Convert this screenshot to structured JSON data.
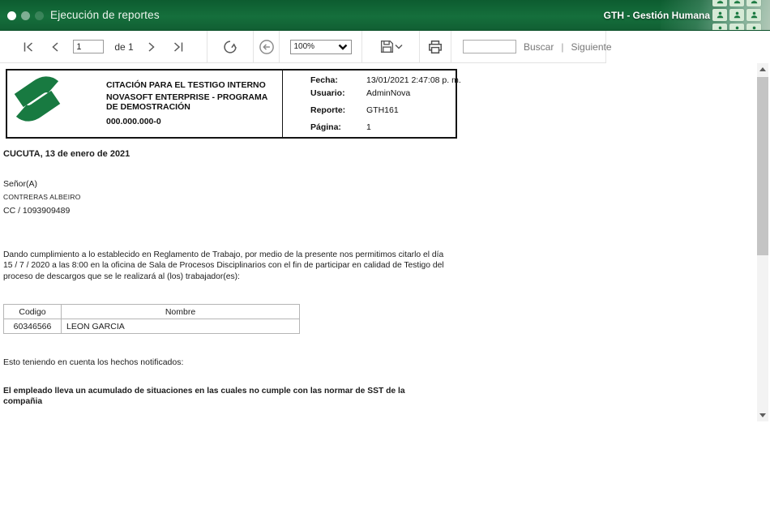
{
  "titlebar": {
    "title": "Ejecución de reportes",
    "module": "GTH - Gestión Humana"
  },
  "toolbar": {
    "page_value": "1",
    "of_label": "de 1",
    "zoom_value": "100%",
    "search_value": "",
    "buscar_label": "Buscar",
    "link_separator": "|",
    "siguiente_label": "Siguiente"
  },
  "report": {
    "header": {
      "title": "CITACIÓN PARA EL TESTIGO INTERNO",
      "company": "NOVASOFT ENTERPRISE  -  PROGRAMA DE DEMOSTRACIÓN",
      "nit": "000.000.000-0",
      "fields": [
        {
          "label": "Fecha:",
          "value": "13/01/2021 2:47:08 p. m."
        },
        {
          "label": "Usuario:",
          "value": "AdminNova"
        },
        {
          "label": "Reporte:",
          "value": "GTH161"
        },
        {
          "label": "Página:",
          "value": "1"
        }
      ]
    },
    "city_date": "CUCUTA, 13 de enero de 2021",
    "salutation": "Señor(A)",
    "recipient_name": "CONTRERAS  ALBEIRO",
    "recipient_id": "CC / 1093909489",
    "body_paragraph": "Dando cumplimiento a lo establecido en Reglamento de Trabajo, por medio de la presente nos permitimos citarlo el día 15 / 7 / 2020 a las 8:00 en la oficina de Sala de Procesos Disciplinarios con el fin de participar en calidad de Testigo del proceso de descargos que se le realizará al (los) trabajador(es):",
    "table": {
      "headers": [
        "Codigo",
        "Nombre"
      ],
      "rows": [
        [
          "60346566",
          "LEON  GARCIA"
        ]
      ]
    },
    "facts_intro": "Esto teniendo en cuenta los hechos notificados:",
    "facts_bold": "El empleado lleva un acumulado de situaciones en las cuales no cumple con las normar de SST de la compañia"
  },
  "colors": {
    "titlebar_green": "#156f3c",
    "logo_green": "#187a41",
    "toolbar_icon_gray": "#5a5a5a"
  }
}
